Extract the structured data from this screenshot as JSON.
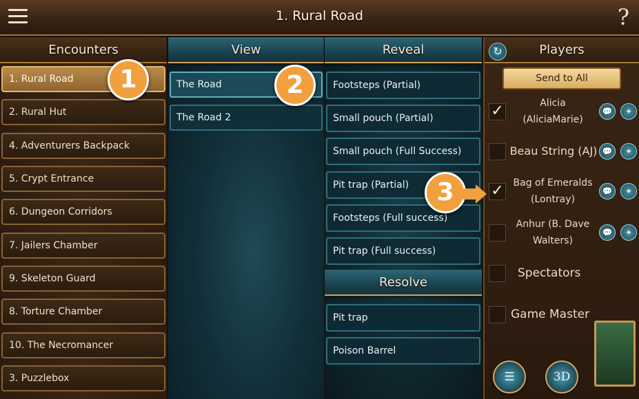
{
  "header": {
    "title": "1. Rural Road",
    "menu_icon": "hamburger-icon",
    "help_label": "?"
  },
  "encounters": {
    "header": "Encounters",
    "items": [
      {
        "label": "1. Rural Road",
        "active": true
      },
      {
        "label": "2. Rural Hut"
      },
      {
        "label": "4. Adventurers Backpack"
      },
      {
        "label": "5. Crypt Entrance"
      },
      {
        "label": "6. Dungeon Corridors"
      },
      {
        "label": "7. Jailers Chamber"
      },
      {
        "label": "9. Skeleton Guard"
      },
      {
        "label": "8. Torture Chamber"
      },
      {
        "label": "10. The Necromancer"
      },
      {
        "label": "3. Puzzlebox"
      }
    ]
  },
  "view": {
    "header": "View",
    "items": [
      {
        "label": "The Road",
        "active": true
      },
      {
        "label": "The Road 2"
      }
    ]
  },
  "reveal": {
    "header": "Reveal",
    "items": [
      {
        "label": "Footsteps (Partial)"
      },
      {
        "label": "Small pouch (Partial)"
      },
      {
        "label": "Small pouch (Full Success)"
      },
      {
        "label": "Pit trap (Partial)"
      },
      {
        "label": "Footsteps (Full success)"
      },
      {
        "label": "Pit trap (Full success)"
      }
    ]
  },
  "resolve": {
    "header": "Resolve",
    "items": [
      {
        "label": "Pit trap"
      },
      {
        "label": "Poison Barrel"
      }
    ]
  },
  "players": {
    "header": "Players",
    "send_all_label": "Send to All",
    "rows": [
      {
        "line1": "Alicia",
        "line2": "(AliciaMarie)",
        "checked": true
      },
      {
        "line1": "Beau String (AJ)",
        "line2": "",
        "checked": false
      },
      {
        "line1": "Bag of Emeralds",
        "line2": "(Lontray)",
        "checked": true
      },
      {
        "line1": "Anhur (B. Dave",
        "line2": "Walters)",
        "checked": false
      }
    ],
    "spectators_label": "Spectators",
    "game_master_label": "Game Master",
    "button_3d_label": "3D",
    "check_glyph": "✓"
  },
  "callouts": [
    "1",
    "2",
    "3"
  ],
  "colors": {
    "accent": "#f2a03d",
    "teal": "#2f6f80",
    "gold": "#d9ae62"
  }
}
